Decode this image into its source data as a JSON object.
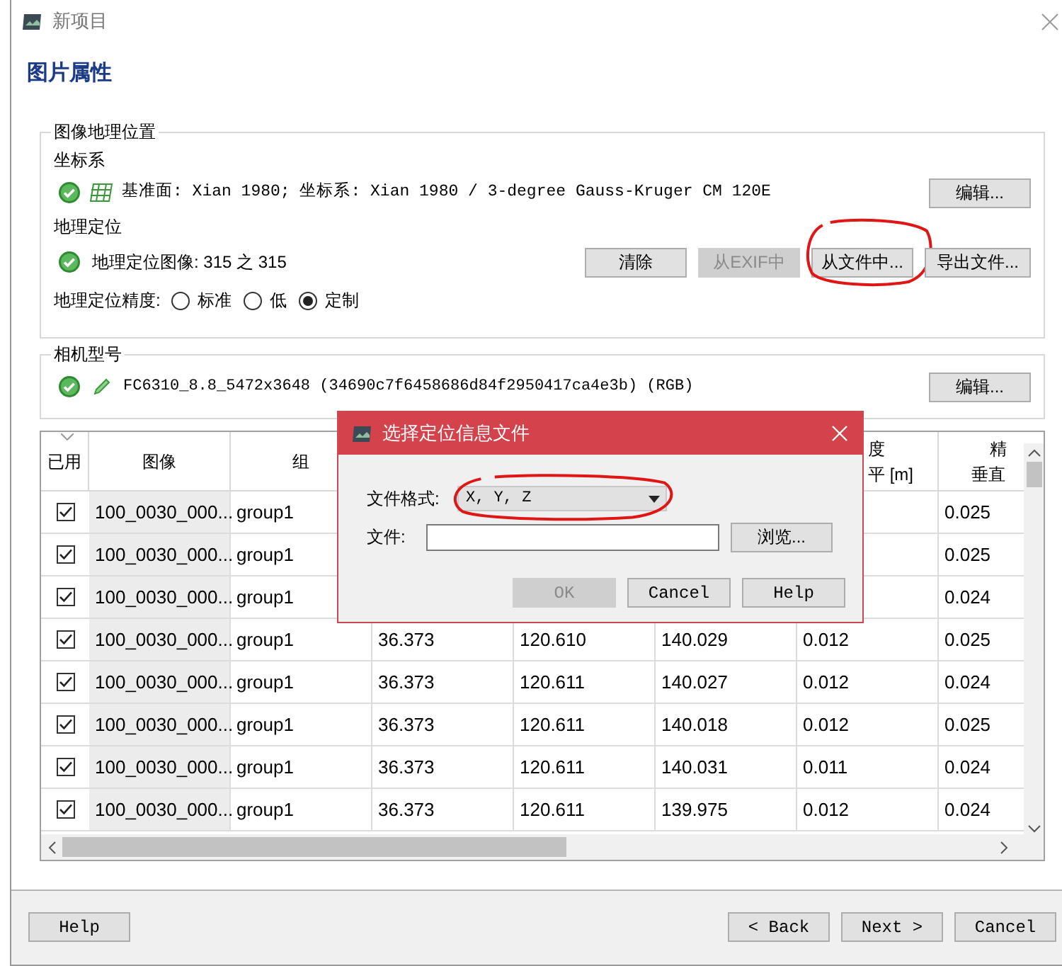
{
  "window": {
    "title": "新项目"
  },
  "page_title": "图片属性",
  "geolocation": {
    "title": "图像地理位置",
    "crs_label": "坐标系",
    "crs_ok": true,
    "crs_text": "基准面: Xian 1980; 坐标系: Xian 1980 / 3-degree Gauss-Kruger CM 120E",
    "crs_button": "编辑...",
    "geo_label": "地理定位",
    "geo_ok": true,
    "geo_text": "地理定位图像: 315 之 315",
    "buttons": [
      {
        "label": "清除",
        "disabled": false,
        "annotated": false
      },
      {
        "label": "从EXIF中",
        "disabled": true,
        "annotated": false
      },
      {
        "label": "从文件中...",
        "disabled": false,
        "annotated": true
      },
      {
        "label": "导出文件...",
        "disabled": false,
        "annotated": false
      }
    ],
    "accuracy_label": "地理定位精度:",
    "accuracy_options": [
      {
        "label": "标准",
        "selected": false
      },
      {
        "label": "低",
        "selected": false
      },
      {
        "label": "定制",
        "selected": true
      }
    ]
  },
  "camera": {
    "title": "相机型号",
    "ok": true,
    "text": "FC6310_8.8_5472x3648 (34690c7f6458686d84f2950417ca4e3b) (RGB)",
    "button": "编辑..."
  },
  "table": {
    "columns": [
      [
        "已用"
      ],
      [
        "图像"
      ],
      [
        "组"
      ],
      null,
      null,
      null,
      [
        "度",
        "平 [m]"
      ],
      [
        "精",
        "垂直"
      ]
    ],
    "rows": [
      {
        "enabled": true,
        "cells": [
          "",
          "100_0030_000...",
          "group1",
          null,
          null,
          null,
          null,
          "0.025"
        ]
      },
      {
        "enabled": true,
        "cells": [
          "",
          "100_0030_000...",
          "group1",
          null,
          null,
          null,
          null,
          "0.025"
        ]
      },
      {
        "enabled": true,
        "cells": [
          "",
          "100_0030_000...",
          "group1",
          null,
          null,
          null,
          null,
          "0.024"
        ]
      },
      {
        "enabled": true,
        "cells": [
          "",
          "100_0030_000...",
          "group1",
          "36.373",
          "120.610",
          "140.029",
          "0.012",
          "0.025"
        ]
      },
      {
        "enabled": true,
        "cells": [
          "",
          "100_0030_000...",
          "group1",
          "36.373",
          "120.611",
          "140.027",
          "0.012",
          "0.024"
        ]
      },
      {
        "enabled": true,
        "cells": [
          "",
          "100_0030_000...",
          "group1",
          "36.373",
          "120.611",
          "140.018",
          "0.012",
          "0.025"
        ]
      },
      {
        "enabled": true,
        "cells": [
          "",
          "100_0030_000...",
          "group1",
          "36.373",
          "120.611",
          "140.031",
          "0.011",
          "0.024"
        ]
      },
      {
        "enabled": true,
        "cells": [
          "",
          "100_0030_000...",
          "group1",
          "36.373",
          "120.611",
          "139.975",
          "0.012",
          "0.024"
        ]
      }
    ]
  },
  "dialog": {
    "title": "选择定位信息文件",
    "format_label": "文件格式:",
    "format_value": "X, Y, Z",
    "format_annotated": true,
    "file_label": "文件:",
    "browse": "浏览...",
    "buttons": [
      {
        "label": "OK",
        "disabled": true
      },
      {
        "label": "Cancel",
        "disabled": false
      },
      {
        "label": "Help",
        "disabled": false
      }
    ]
  },
  "footer": {
    "help": "Help",
    "buttons": [
      "< Back",
      "Next >",
      "Cancel"
    ]
  }
}
